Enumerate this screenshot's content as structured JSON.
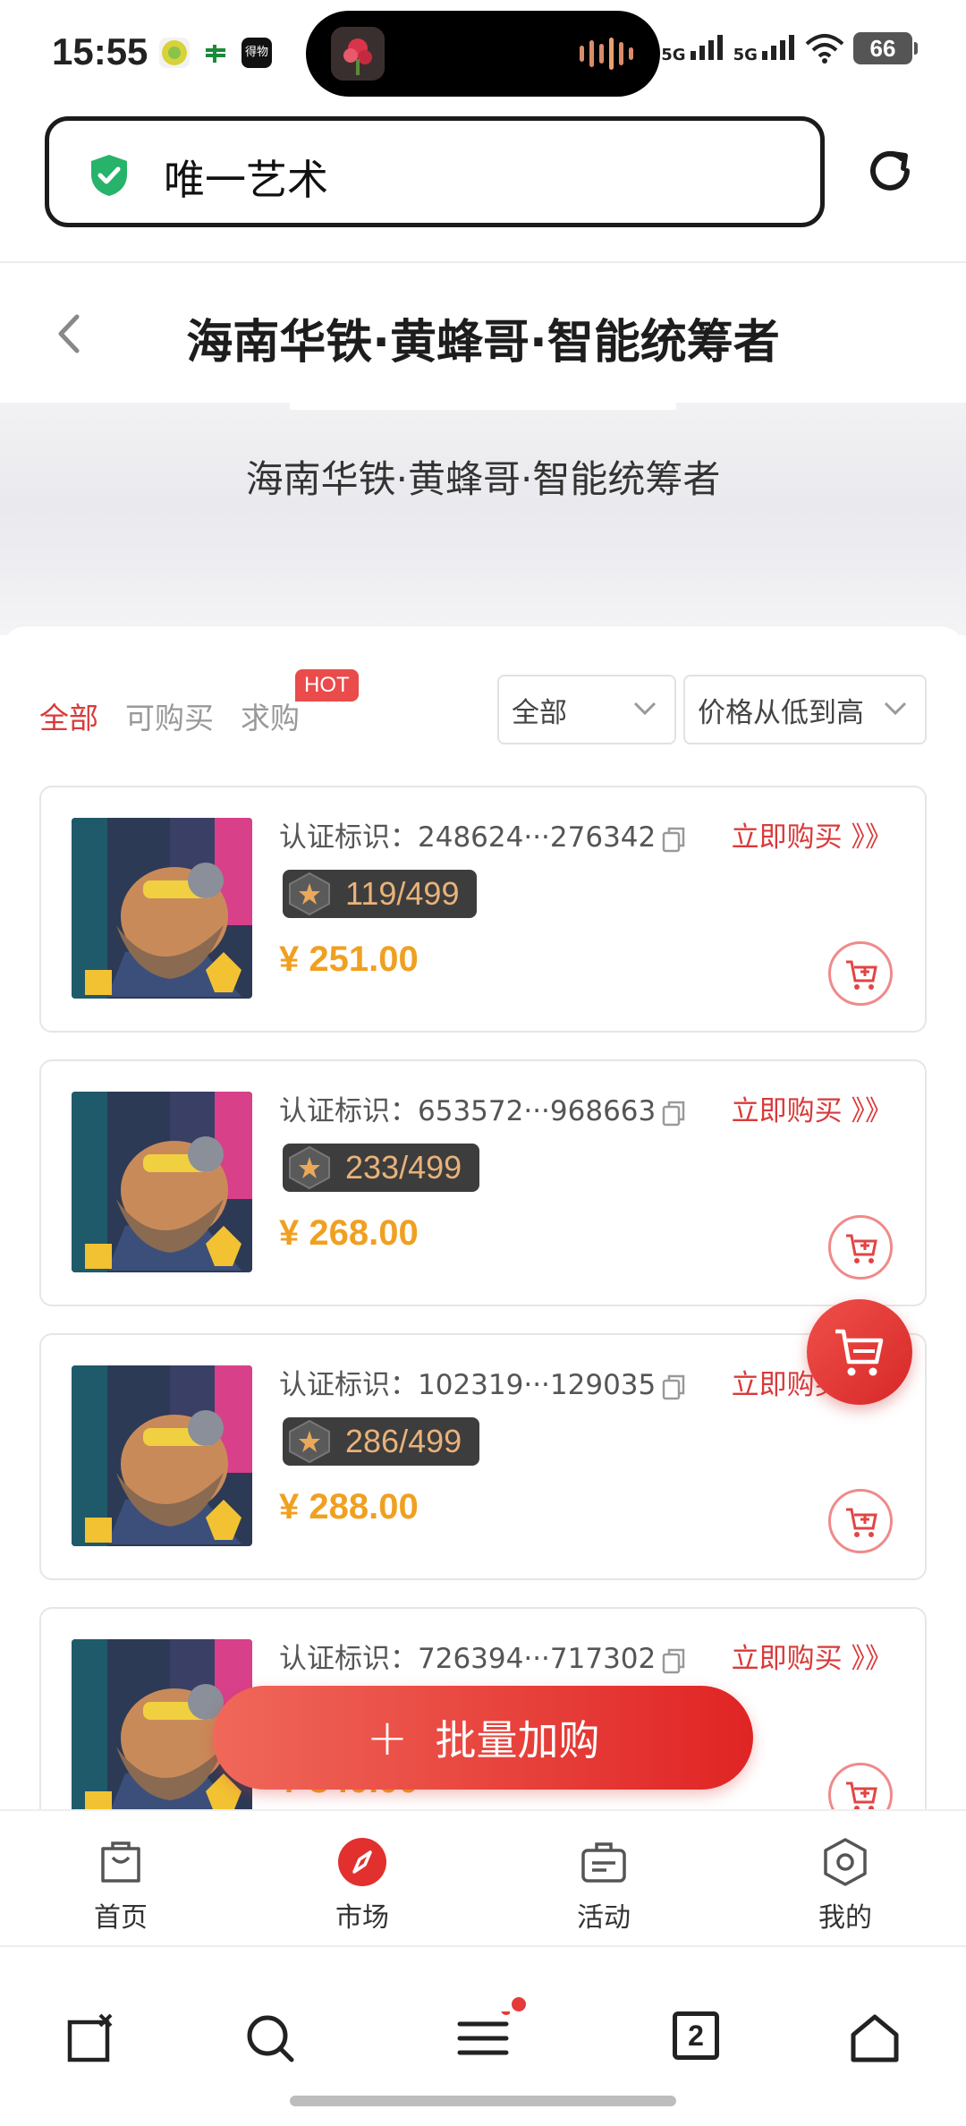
{
  "status_bar": {
    "time": "15:55",
    "signal1": "5G",
    "signal2": "5G",
    "battery": "66",
    "app_badge": "得物"
  },
  "browser": {
    "url_text": "唯一艺术",
    "tabs_count": "2"
  },
  "header": {
    "title": "海南华铁·黄蜂哥·智能统筹者"
  },
  "banner": {
    "title": "海南华铁·黄蜂哥·智能统筹者"
  },
  "filters": {
    "tabs": [
      {
        "label": "全部",
        "active": true
      },
      {
        "label": "可购买",
        "active": false
      },
      {
        "label": "求购",
        "active": false
      }
    ],
    "hot_badge": "HOT",
    "category_select": "全部",
    "sort_select": "价格从低到高"
  },
  "listings": [
    {
      "cert_label": "认证标识：",
      "cert_id": "248624···276342",
      "edition": "119/499",
      "price": "¥ 251.00",
      "buy_label": "立即购买 》》"
    },
    {
      "cert_label": "认证标识：",
      "cert_id": "653572···968663",
      "edition": "233/499",
      "price": "¥ 268.00",
      "buy_label": "立即购买 》》"
    },
    {
      "cert_label": "认证标识：",
      "cert_id": "102319···129035",
      "edition": "286/499",
      "price": "¥ 288.00",
      "buy_label": "立即购买 》》"
    },
    {
      "cert_label": "认证标识：",
      "cert_id": "726394···717302",
      "edition": "",
      "price": "¥ 340.00",
      "buy_label": "立即购买 》》"
    }
  ],
  "bulk_button": {
    "plus": "+",
    "label": "批量加购"
  },
  "app_nav": [
    {
      "label": "首页",
      "icon": "shopping-bag-icon"
    },
    {
      "label": "市场",
      "icon": "compass-icon",
      "active": true
    },
    {
      "label": "活动",
      "icon": "briefcase-icon"
    },
    {
      "label": "我的",
      "icon": "hexagon-icon"
    }
  ],
  "colors": {
    "accent_red": "#d93a3a",
    "price_orange": "#f0a020",
    "edition_bg": "#3d3d3d",
    "edition_text": "#e9b27a"
  }
}
